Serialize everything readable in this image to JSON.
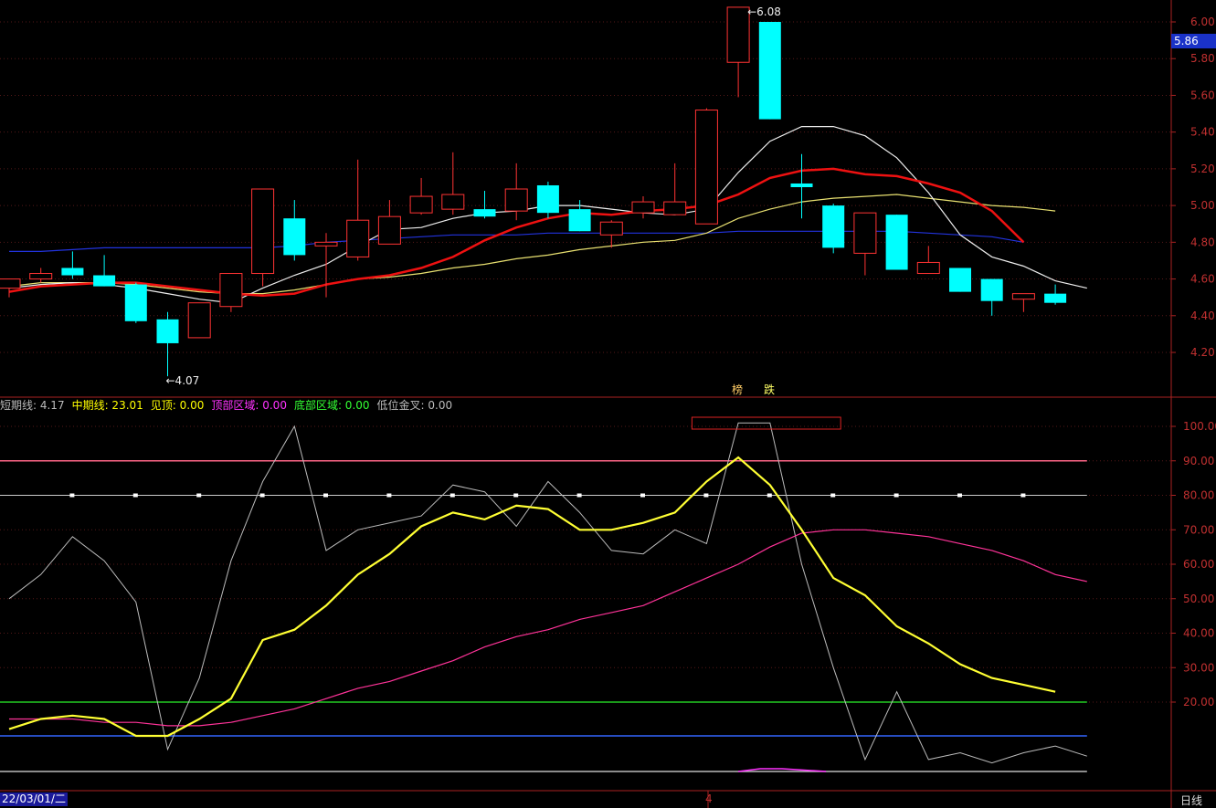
{
  "chart_data": [
    {
      "type": "candlestick",
      "yaxis_ticks": [
        "4.20",
        "4.40",
        "4.60",
        "4.80",
        "5.00",
        "5.20",
        "5.40",
        "5.60",
        "5.80",
        "6.00"
      ],
      "ylim": [
        4.0,
        6.1
      ],
      "current_price": "5.86",
      "high_annotation": "6.08",
      "low_annotation": "4.07",
      "candles": [
        {
          "o": 4.55,
          "h": 4.6,
          "l": 4.5,
          "c": 4.6
        },
        {
          "o": 4.6,
          "h": 4.66,
          "l": 4.58,
          "c": 4.63
        },
        {
          "o": 4.66,
          "h": 4.75,
          "l": 4.6,
          "c": 4.62
        },
        {
          "o": 4.62,
          "h": 4.73,
          "l": 4.56,
          "c": 4.56
        },
        {
          "o": 4.57,
          "h": 4.58,
          "l": 4.36,
          "c": 4.37
        },
        {
          "o": 4.38,
          "h": 4.42,
          "l": 4.07,
          "c": 4.25
        },
        {
          "o": 4.28,
          "h": 4.47,
          "l": 4.28,
          "c": 4.47
        },
        {
          "o": 4.45,
          "h": 4.63,
          "l": 4.42,
          "c": 4.63
        },
        {
          "o": 4.63,
          "h": 5.09,
          "l": 4.56,
          "c": 5.09
        },
        {
          "o": 4.93,
          "h": 5.03,
          "l": 4.7,
          "c": 4.73
        },
        {
          "o": 4.78,
          "h": 4.85,
          "l": 4.5,
          "c": 4.8
        },
        {
          "o": 4.72,
          "h": 5.25,
          "l": 4.7,
          "c": 4.92
        },
        {
          "o": 4.79,
          "h": 5.03,
          "l": 4.79,
          "c": 4.94
        },
        {
          "o": 4.96,
          "h": 5.15,
          "l": 4.95,
          "c": 5.05
        },
        {
          "o": 4.98,
          "h": 5.29,
          "l": 4.95,
          "c": 5.06
        },
        {
          "o": 4.98,
          "h": 5.08,
          "l": 4.93,
          "c": 4.94
        },
        {
          "o": 4.97,
          "h": 5.23,
          "l": 4.92,
          "c": 5.09
        },
        {
          "o": 5.11,
          "h": 5.13,
          "l": 4.93,
          "c": 4.96
        },
        {
          "o": 4.98,
          "h": 5.03,
          "l": 4.86,
          "c": 4.86
        },
        {
          "o": 4.84,
          "h": 4.92,
          "l": 4.77,
          "c": 4.91
        },
        {
          "o": 4.96,
          "h": 5.05,
          "l": 4.93,
          "c": 5.02
        },
        {
          "o": 4.95,
          "h": 5.23,
          "l": 4.95,
          "c": 5.02
        },
        {
          "o": 4.9,
          "h": 5.53,
          "l": 4.9,
          "c": 5.52
        },
        {
          "o": 5.78,
          "h": 6.08,
          "l": 5.59,
          "c": 6.08
        },
        {
          "o": 6.0,
          "h": 6.0,
          "l": 5.47,
          "c": 5.47
        },
        {
          "o": 5.12,
          "h": 5.28,
          "l": 4.93,
          "c": 5.1
        },
        {
          "o": 5.0,
          "h": 5.01,
          "l": 4.74,
          "c": 4.77
        },
        {
          "o": 4.74,
          "h": 4.96,
          "l": 4.62,
          "c": 4.96
        },
        {
          "o": 4.95,
          "h": 4.95,
          "l": 4.65,
          "c": 4.65
        },
        {
          "o": 4.63,
          "h": 4.78,
          "l": 4.63,
          "c": 4.69
        },
        {
          "o": 4.66,
          "h": 4.66,
          "l": 4.53,
          "c": 4.53
        },
        {
          "o": 4.6,
          "h": 4.6,
          "l": 4.4,
          "c": 4.48
        },
        {
          "o": 4.49,
          "h": 4.52,
          "l": 4.42,
          "c": 4.52
        },
        {
          "o": 4.52,
          "h": 4.57,
          "l": 4.46,
          "c": 4.47
        }
      ],
      "ma_white": [
        4.55,
        4.57,
        4.58,
        4.57,
        4.55,
        4.52,
        4.49,
        4.47,
        4.55,
        4.62,
        4.68,
        4.78,
        4.87,
        4.88,
        4.93,
        4.96,
        4.97,
        5.0,
        5.0,
        4.98,
        4.96,
        4.95,
        4.98,
        5.18,
        5.35,
        5.43,
        5.43,
        5.38,
        5.26,
        5.07,
        4.84,
        4.72,
        4.67,
        4.59,
        4.55
      ],
      "ma_red": [
        4.53,
        4.56,
        4.57,
        4.58,
        4.58,
        4.56,
        4.54,
        4.52,
        4.51,
        4.52,
        4.57,
        4.6,
        4.62,
        4.66,
        4.72,
        4.81,
        4.88,
        4.93,
        4.96,
        4.95,
        4.97,
        4.98,
        5.0,
        5.06,
        5.15,
        5.19,
        5.2,
        5.17,
        5.16,
        5.12,
        5.07,
        4.97,
        4.8
      ],
      "ma_yellow": [
        4.56,
        4.58,
        4.58,
        4.58,
        4.57,
        4.55,
        4.53,
        4.52,
        4.52,
        4.54,
        4.57,
        4.6,
        4.61,
        4.63,
        4.66,
        4.68,
        4.71,
        4.73,
        4.76,
        4.78,
        4.8,
        4.81,
        4.85,
        4.93,
        4.98,
        5.02,
        5.04,
        5.05,
        5.06,
        5.04,
        5.02,
        5.0,
        4.99,
        4.97
      ],
      "ma_blue": [
        4.75,
        4.75,
        4.76,
        4.77,
        4.77,
        4.77,
        4.77,
        4.77,
        4.77,
        4.78,
        4.8,
        4.81,
        4.82,
        4.83,
        4.84,
        4.84,
        4.84,
        4.85,
        4.85,
        4.85,
        4.85,
        4.85,
        4.85,
        4.86,
        4.86,
        4.86,
        4.86,
        4.86,
        4.86,
        4.85,
        4.84,
        4.83,
        4.8
      ]
    },
    {
      "type": "line",
      "yaxis_ticks": [
        "20.00",
        "30.00",
        "40.00",
        "50.00",
        "60.00",
        "70.00",
        "80.00",
        "90.00",
        "100.00"
      ],
      "ylim": [
        0,
        104
      ],
      "legend": [
        {
          "label": "短期线: 4.17",
          "color": "#bbbbbb"
        },
        {
          "label": "中期线: 23.01",
          "color": "#ffff00"
        },
        {
          "label": "见顶: 0.00",
          "color": "#ffff00"
        },
        {
          "label": "顶部区域: 0.00",
          "color": "#ff33ff"
        },
        {
          "label": "底部区域: 0.00",
          "color": "#33ff33"
        },
        {
          "label": "低位金叉: 0.00",
          "color": "#bbbbbb"
        }
      ],
      "hlines": [
        {
          "y": 90,
          "color": "#ff6688"
        },
        {
          "y": 80,
          "color": "#cccccc",
          "dashed": true
        },
        {
          "y": 20,
          "color": "#22cc22"
        },
        {
          "y": 10,
          "color": "#3366ff"
        },
        {
          "y": 0,
          "color": "#bbbbbb"
        }
      ],
      "short_line": [
        50,
        57,
        68,
        61,
        49,
        6,
        27,
        61,
        84,
        100,
        64,
        70,
        72,
        74,
        83,
        81,
        71,
        84,
        75,
        64,
        63,
        70,
        66,
        101,
        101,
        60,
        30,
        3,
        23,
        3,
        5,
        2,
        5,
        7,
        4
      ],
      "mid_line": [
        12,
        15,
        16,
        15,
        10,
        10,
        15,
        21,
        38,
        41,
        48,
        57,
        63,
        71,
        75,
        73,
        77,
        76,
        70,
        70,
        72,
        75,
        84,
        91,
        83,
        70,
        56,
        51,
        42,
        37,
        31,
        27,
        25,
        23
      ],
      "pink_line": [
        15,
        15,
        15,
        14,
        14,
        13,
        13,
        14,
        16,
        18,
        21,
        24,
        26,
        29,
        32,
        36,
        39,
        41,
        44,
        46,
        48,
        52,
        56,
        60,
        65,
        69,
        70,
        70,
        69,
        68,
        66,
        64,
        61,
        57,
        55
      ],
      "magenta_arc": [
        0,
        1,
        1,
        0.5,
        0
      ],
      "top_box": {
        "x_from_index": 22,
        "x_to_index": 26
      }
    }
  ],
  "markers": {
    "tag_left": "榜",
    "tag_right": "跌"
  },
  "footer": {
    "date": "22/03/01/二",
    "month": "4",
    "period": "日线"
  }
}
